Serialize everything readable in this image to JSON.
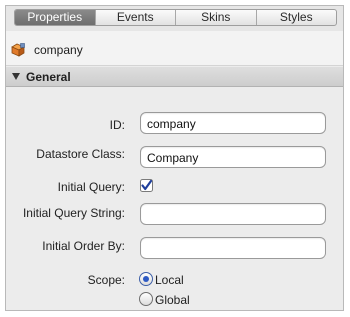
{
  "tabs": [
    {
      "label": "Properties",
      "active": true
    },
    {
      "label": "Events",
      "active": false
    },
    {
      "label": "Skins",
      "active": false
    },
    {
      "label": "Styles",
      "active": false
    }
  ],
  "object": {
    "icon": "datasource-cube-icon",
    "name": "company"
  },
  "section": {
    "title": "General",
    "expanded": true
  },
  "form": {
    "id": {
      "label": "ID:",
      "value": "company"
    },
    "datastore_class": {
      "label": "Datastore Class:",
      "value": "Company"
    },
    "initial_query": {
      "label": "Initial Query:",
      "checked": true
    },
    "initial_query_string": {
      "label": "Initial Query String:",
      "value": ""
    },
    "initial_order_by": {
      "label": "Initial Order By:",
      "value": ""
    },
    "scope": {
      "label": "Scope:",
      "options": [
        {
          "label": "Local",
          "selected": true
        },
        {
          "label": "Global",
          "selected": false
        }
      ]
    }
  },
  "colors": {
    "active_tab": "#7b7b7b",
    "radio_selected": "#2c59c4",
    "checkmark": "#1f3f9c",
    "object_icon": "#e07a2a"
  }
}
